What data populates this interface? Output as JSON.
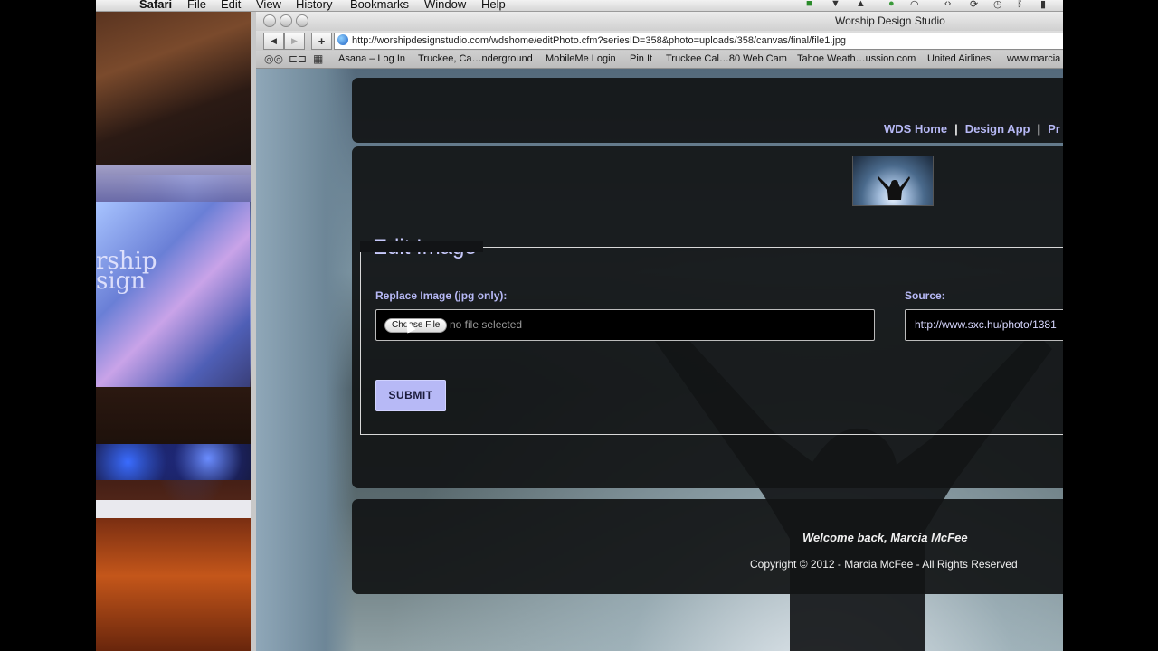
{
  "menubar": {
    "app": "Safari",
    "items": [
      "File",
      "Edit",
      "View",
      "History",
      "Bookmarks",
      "Window",
      "Help"
    ]
  },
  "window": {
    "title": "Worship Design Studio"
  },
  "toolbar": {
    "back_glyph": "◀",
    "forward_glyph": "▶",
    "add_glyph": "+",
    "url": "http://worshipdesignstudio.com/wdshome/editPhoto.cfm?seriesID=358&photo=uploads/358/canvas/final/file1.jpg"
  },
  "bookmarks": {
    "items": [
      "Asana – Log In",
      "Truckee, Ca…nderground",
      "MobileMe Login",
      "Pin It",
      "Truckee Cal…80 Web Cam",
      "Tahoe Weath…ussion.com",
      "United Airlines",
      "www.marcia"
    ]
  },
  "desktop": {
    "screen_text_line1": "rship",
    "screen_text_line2": "sign"
  },
  "page": {
    "nav": [
      {
        "label": "WDS Home"
      },
      {
        "label": "Design App"
      },
      {
        "label": "Pr"
      }
    ],
    "nav_separator": "|",
    "form": {
      "legend": "Edit Image",
      "replace_label": "Replace Image (jpg only):",
      "choose_file_label": "Choose File",
      "no_file_text": "no file selected",
      "source_label": "Source:",
      "source_value": "http://www.sxc.hu/photo/1381",
      "submit_label": "SUBMIT"
    },
    "footer": {
      "welcome": "Welcome back, Marcia McFee",
      "copyright": "Copyright © 2012 - Marcia McFee - All Rights Reserved"
    }
  },
  "colors": {
    "accent": "#b7b9f6",
    "panel_bg": "#121416"
  }
}
